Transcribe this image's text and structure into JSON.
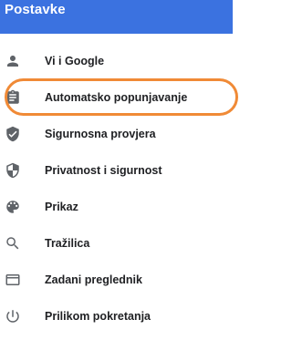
{
  "header": {
    "title": "Postavke",
    "background": "#3b72e0"
  },
  "highlight": {
    "color": "#f08a36",
    "target": "Automatsko popunjavanje"
  },
  "menu": {
    "items": [
      {
        "label": "Vi i Google",
        "icon": "person-icon"
      },
      {
        "label": "Automatsko popunjavanje",
        "icon": "clipboard-icon"
      },
      {
        "label": "Sigurnosna provjera",
        "icon": "shield-check-icon"
      },
      {
        "label": "Privatnost i sigurnost",
        "icon": "shield-half-icon"
      },
      {
        "label": "Prikaz",
        "icon": "palette-icon"
      },
      {
        "label": "Tražilica",
        "icon": "search-icon"
      },
      {
        "label": "Zadani preglednik",
        "icon": "browser-window-icon"
      },
      {
        "label": "Prilikom pokretanja",
        "icon": "power-icon"
      }
    ]
  }
}
